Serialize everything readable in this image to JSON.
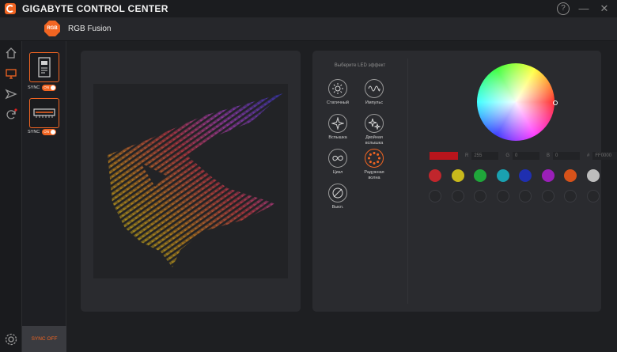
{
  "app": {
    "title": "GIGABYTE CONTROL CENTER"
  },
  "window": {
    "help": "?",
    "minimize": "—",
    "close": "✕"
  },
  "module": {
    "badge": "RGB",
    "title": "RGB Fusion"
  },
  "devices": [
    {
      "sync_label": "SYNC",
      "toggle": "ON"
    },
    {
      "sync_label": "SYNC",
      "toggle": "ON"
    }
  ],
  "sync_off_label": "SYNC OFF",
  "effects": {
    "title": "Выберите LED эффект",
    "items": [
      {
        "label": "Статичный",
        "icon": "sun-icon"
      },
      {
        "label": "Импульс",
        "icon": "pulse-icon"
      },
      {
        "label": "Вспышка",
        "icon": "flash-icon"
      },
      {
        "label": "Двойная вспышка",
        "icon": "double-flash-icon"
      },
      {
        "label": "Цикл",
        "icon": "cycle-icon"
      },
      {
        "label": "Радужная волна",
        "icon": "rainbow-wave-icon"
      },
      {
        "label": "Выкл.",
        "icon": "off-icon"
      }
    ]
  },
  "color": {
    "current": "#b8151c",
    "r_label": "R",
    "r_value": "255",
    "g_label": "G",
    "g_value": "0",
    "b_label": "B",
    "b_value": "0",
    "hex_label": "#",
    "hex_value": "FF0000",
    "presets": [
      "#c0262c",
      "#c8b81c",
      "#1fa63a",
      "#1aa1b0",
      "#1f2fb0",
      "#9a1fb8",
      "#d6521a",
      "#bdbdbd"
    ],
    "custom_slots": 8
  },
  "accent": "#f26522"
}
